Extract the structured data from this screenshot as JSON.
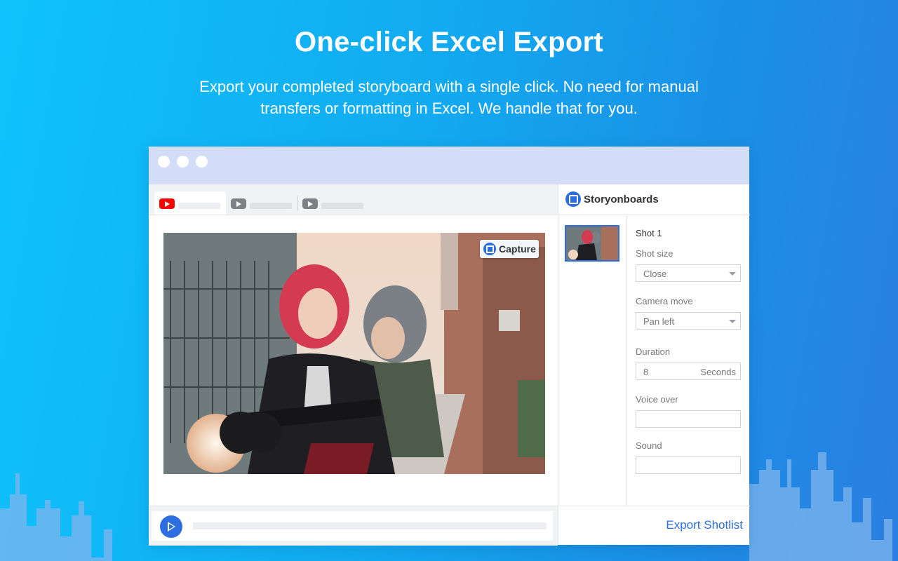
{
  "hero": {
    "title": "One-click Excel Export",
    "subtitle": "Export your completed storyboard with a single click. No need for manual transfers or formatting in Excel. We handle that for you."
  },
  "browser": {
    "tabs": [
      {
        "icon": "youtube-icon",
        "active": true
      },
      {
        "icon": "youtube-icon",
        "active": false
      },
      {
        "icon": "youtube-icon",
        "active": false
      }
    ]
  },
  "player": {
    "capture_label": "Capture",
    "play_icon": "play-icon",
    "image_description": "illustration of a red-haired woman riding a motorcycle with a passenger in a narrow alley"
  },
  "panel": {
    "app_name": "Storyonboards",
    "shot_title": "Shot 1",
    "shot_size_label": "Shot size",
    "shot_size_value": "Close",
    "camera_move_label": "Camera move",
    "camera_move_value": "Pan left",
    "duration_label": "Duration",
    "duration_value": "8",
    "duration_unit": "Seconds",
    "voice_over_label": "Voice over",
    "voice_over_value": "",
    "sound_label": "Sound",
    "sound_value": "",
    "export_label": "Export Shotlist"
  },
  "colors": {
    "accent": "#2c6ee0",
    "youtube_red": "#ff0000",
    "titlebar": "#d3ddf7"
  }
}
